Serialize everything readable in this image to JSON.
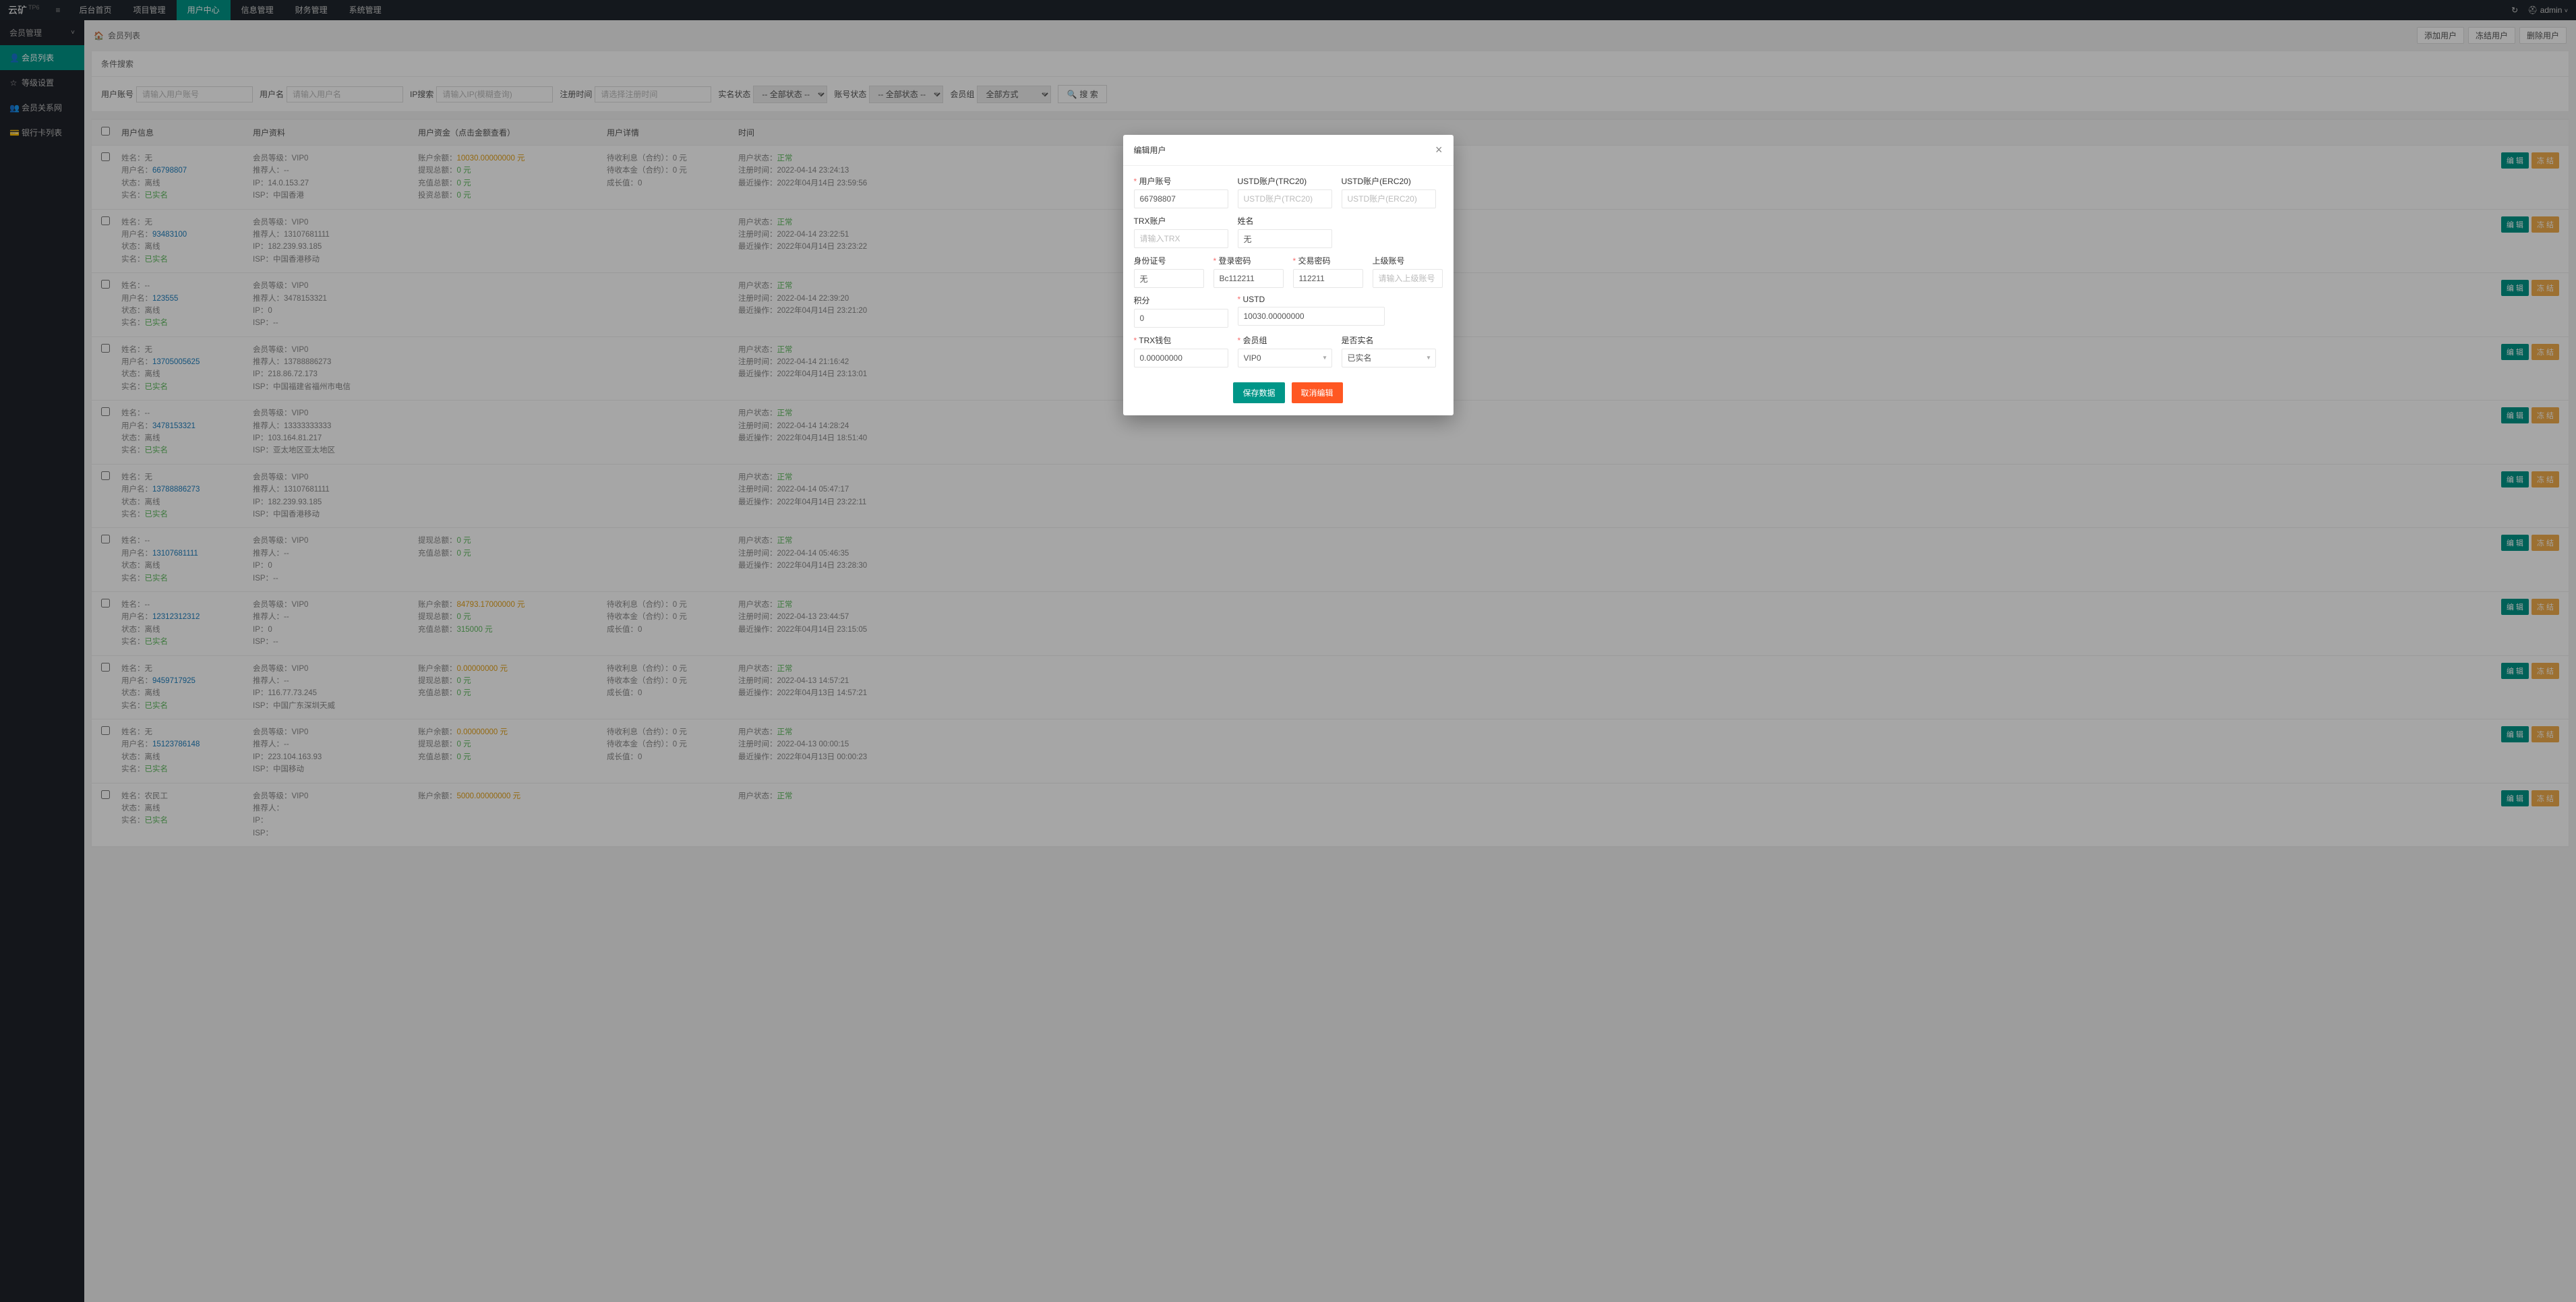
{
  "brand": {
    "name": "云矿",
    "suffix": "TP6"
  },
  "topnav": [
    "后台首页",
    "项目管理",
    "用户中心",
    "信息管理",
    "财务管理",
    "系统管理"
  ],
  "topnav_active": 2,
  "user": "admin",
  "sidebar": {
    "group": "会员管理",
    "items": [
      {
        "icon": "👤",
        "label": "会员列表",
        "active": true
      },
      {
        "icon": "☆",
        "label": "等级设置"
      },
      {
        "icon": "👥",
        "label": "会员关系网"
      },
      {
        "icon": "💳",
        "label": "银行卡列表"
      }
    ]
  },
  "breadcrumb": {
    "title": "会员列表"
  },
  "page_actions": [
    "添加用户",
    "冻结用户",
    "删除用户"
  ],
  "search": {
    "title": "条件搜索",
    "fields": [
      {
        "label": "用户账号",
        "ph": "请输入用户账号",
        "type": "text"
      },
      {
        "label": "用户名",
        "ph": "请输入用户名",
        "type": "text"
      },
      {
        "label": "IP搜索",
        "ph": "请输入IP(模糊查询)",
        "type": "text"
      },
      {
        "label": "注册时间",
        "ph": "请选择注册时间",
        "type": "text"
      },
      {
        "label": "实名状态",
        "ph": "-- 全部状态 --",
        "type": "select"
      },
      {
        "label": "账号状态",
        "ph": "-- 全部状态 --",
        "type": "select"
      },
      {
        "label": "会员组",
        "ph": "全部方式",
        "type": "select"
      }
    ],
    "btn": "搜 索"
  },
  "columns": {
    "info": "用户信息",
    "prof": "用户资料",
    "fund": "用户资金（点击金额查看）",
    "detail": "用户详情",
    "time": "时间"
  },
  "labels": {
    "name": "姓名：",
    "user": "用户名：",
    "status": "状态：",
    "real": "实名：",
    "level": "会员等级：",
    "ref": "推荐人：",
    "ip": "IP：",
    "isp": "ISP：",
    "balance": "账户余额：",
    "withdraw": "提现总额：",
    "recharge": "充值总额：",
    "invest": "投资总额：",
    "interest": "待收利息（合约）：",
    "principal": "待收本金（合约）：",
    "growth": "成长值：",
    "ustatus": "用户状态：",
    "regtime": "注册时间：",
    "lastop": "最近操作：",
    "yuan": "元",
    "normal": "正常",
    "offline": "离线",
    "realnamed": "已实名",
    "edit": "编 辑",
    "freeze": "冻 结"
  },
  "rows": [
    {
      "name": "无",
      "user": "66798807",
      "level": "VIP0",
      "ref": "--",
      "ip": "14.0.153.27",
      "isp": "中国香港",
      "balance": "10030.00000000 元",
      "withdraw": "0 元",
      "recharge": "0 元",
      "invest": "0 元",
      "interest": "0 元",
      "principal": "0 元",
      "growth": "0",
      "reg": "2022-04-14 23:24:13",
      "last": "2022年04月14日 23:59:56"
    },
    {
      "name": "无",
      "user": "93483100",
      "level": "VIP0",
      "ref": "13107681111",
      "ip": "182.239.93.185",
      "isp": "中国香港移动",
      "balance": "",
      "withdraw": "",
      "recharge": "",
      "invest": "",
      "interest": "",
      "principal": "",
      "growth": "",
      "reg": "2022-04-14 23:22:51",
      "last": "2022年04月14日 23:23:22"
    },
    {
      "name": "--",
      "user": "123555",
      "level": "VIP0",
      "ref": "3478153321",
      "ip": "0",
      "isp": "--",
      "balance": "",
      "withdraw": "",
      "recharge": "",
      "invest": "",
      "interest": "",
      "principal": "",
      "growth": "",
      "reg": "2022-04-14 22:39:20",
      "last": "2022年04月14日 23:21:20"
    },
    {
      "name": "无",
      "user": "13705005625",
      "level": "VIP0",
      "ref": "13788886273",
      "ip": "218.86.72.173",
      "isp": "中国福建省福州市电信",
      "balance": "",
      "withdraw": "",
      "recharge": "",
      "invest": "",
      "interest": "",
      "principal": "",
      "growth": "",
      "reg": "2022-04-14 21:16:42",
      "last": "2022年04月14日 23:13:01"
    },
    {
      "name": "--",
      "user": "3478153321",
      "level": "VIP0",
      "ref": "13333333333",
      "ip": "103.164.81.217",
      "isp": "亚太地区亚太地区",
      "balance": "",
      "withdraw": "",
      "recharge": "",
      "invest": "",
      "interest": "",
      "principal": "",
      "growth": "",
      "reg": "2022-04-14 14:28:24",
      "last": "2022年04月14日 18:51:40"
    },
    {
      "name": "无",
      "user": "13788886273",
      "level": "VIP0",
      "ref": "13107681111",
      "ip": "182.239.93.185",
      "isp": "中国香港移动",
      "balance": "",
      "withdraw": "",
      "recharge": "",
      "invest": "",
      "interest": "",
      "principal": "",
      "growth": "",
      "reg": "2022-04-14 05:47:17",
      "last": "2022年04月14日 23:22:11"
    },
    {
      "name": "--",
      "user": "13107681111",
      "level": "VIP0",
      "ref": "--",
      "ip": "0",
      "isp": "--",
      "balance": "",
      "withdraw": "0 元",
      "recharge": "0 元",
      "invest": "",
      "interest": "",
      "principal": "",
      "growth": "",
      "reg": "2022-04-14 05:46:35",
      "last": "2022年04月14日 23:28:30"
    },
    {
      "name": "--",
      "user": "12312312312",
      "level": "VIP0",
      "ref": "--",
      "ip": "0",
      "isp": "--",
      "balance": "84793.17000000 元",
      "withdraw": "0 元",
      "recharge": "315000 元",
      "invest": "",
      "interest": "0 元",
      "principal": "0 元",
      "growth": "0",
      "reg": "2022-04-13 23:44:57",
      "last": "2022年04月14日 23:15:05"
    },
    {
      "name": "无",
      "user": "9459717925",
      "level": "VIP0",
      "ref": "--",
      "ip": "116.77.73.245",
      "isp": "中国广东深圳天威",
      "balance": "0.00000000 元",
      "withdraw": "0 元",
      "recharge": "0 元",
      "invest": "",
      "interest": "0 元",
      "principal": "0 元",
      "growth": "0",
      "reg": "2022-04-13 14:57:21",
      "last": "2022年04月13日 14:57:21"
    },
    {
      "name": "无",
      "user": "15123786148",
      "level": "VIP0",
      "ref": "--",
      "ip": "223.104.163.93",
      "isp": "中国移动",
      "balance": "0.00000000 元",
      "withdraw": "0 元",
      "recharge": "0 元",
      "invest": "",
      "interest": "0 元",
      "principal": "0 元",
      "growth": "0",
      "reg": "2022-04-13 00:00:15",
      "last": "2022年04月13日 00:00:23"
    },
    {
      "name": "农民工",
      "user": "",
      "level": "VIP0",
      "ref": "",
      "ip": "",
      "isp": "",
      "balance": "5000.00000000 元",
      "withdraw": "",
      "recharge": "",
      "invest": "",
      "interest": "",
      "principal": "",
      "growth": "",
      "reg": "",
      "last": ""
    }
  ],
  "modal": {
    "title": "编辑用户",
    "fields": {
      "account": {
        "label": "用户账号",
        "val": "66798807"
      },
      "ustd20": {
        "label": "USTD账户(TRC20)",
        "ph": "USTD账户(TRC20)"
      },
      "ustde20": {
        "label": "USTD账户(ERC20)",
        "ph": "USTD账户(ERC20)"
      },
      "trx": {
        "label": "TRX账户",
        "ph": "请输入TRX"
      },
      "name": {
        "label": "姓名",
        "val": "无"
      },
      "idcard": {
        "label": "身份证号",
        "val": "无"
      },
      "loginpwd": {
        "label": "登录密码",
        "val": "Bc112211"
      },
      "tradepwd": {
        "label": "交易密码",
        "val": "112211"
      },
      "parent": {
        "label": "上级账号",
        "ph": "请输入上级账号"
      },
      "points": {
        "label": "积分",
        "val": "0"
      },
      "ustd": {
        "label": "USTD",
        "val": "10030.00000000"
      },
      "trxwallet": {
        "label": "TRX钱包",
        "val": "0.00000000"
      },
      "group": {
        "label": "会员组",
        "val": "VIP0"
      },
      "isreal": {
        "label": "是否实名",
        "val": "已实名"
      }
    },
    "save": "保存数据",
    "cancel": "取消编辑"
  }
}
